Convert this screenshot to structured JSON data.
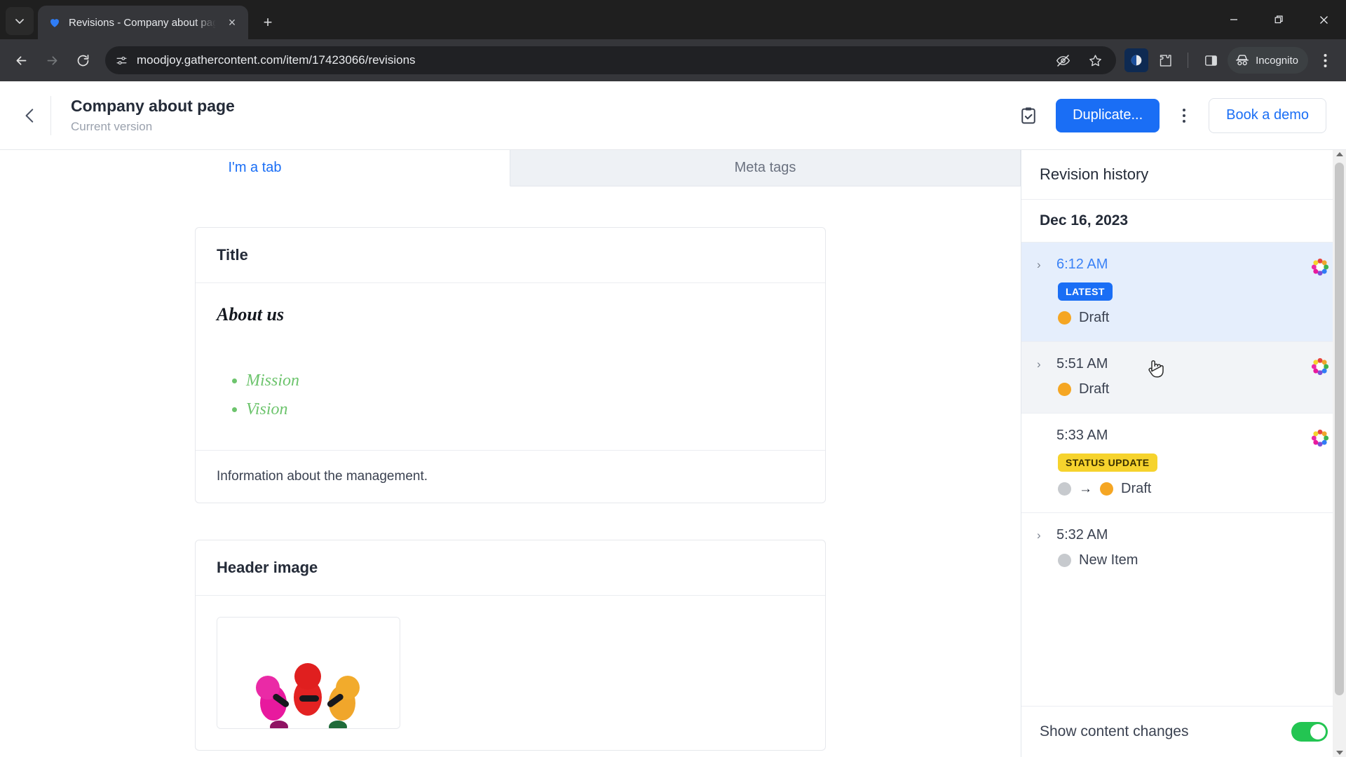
{
  "browser": {
    "tab": {
      "title": "Revisions - Company about pag",
      "favicon": "gathercontent-heart-icon",
      "close": "×"
    },
    "new_tab": "+",
    "window_controls": {
      "minimize": "—",
      "maximize": "❐",
      "close": "✕"
    },
    "toolbar": {
      "back": "←",
      "forward": "→",
      "reload": "↻",
      "site_info": "site-settings-icon",
      "url": "moodjoy.gathercontent.com/item/17423066/revisions",
      "hide_icon": "eye-slash-icon",
      "bookmark_icon": "star-icon",
      "extension_puzzle": "puzzle-piece-icon",
      "side_panel": "side-panel-icon",
      "profile_label": "Incognito",
      "menu": "kebab-menu-icon"
    }
  },
  "app": {
    "header": {
      "back": "back-chevron",
      "title": "Company about page",
      "subtitle": "Current version",
      "clipboard_icon": "clipboard-check-icon",
      "duplicate_label": "Duplicate...",
      "more_menu": "more-options",
      "book_demo_label": "Book a demo"
    },
    "tabs": [
      {
        "label": "I'm a tab",
        "active": true
      },
      {
        "label": "Meta tags",
        "active": false
      }
    ],
    "content": {
      "cards": [
        {
          "heading": "Title",
          "rich_heading": "About us",
          "bullets": [
            "Mission",
            "Vision"
          ],
          "footer_text": "Information about the management."
        },
        {
          "heading": "Header image",
          "image_alt": "colorful-people-illustration"
        }
      ]
    }
  },
  "panel": {
    "title": "Revision history",
    "date_group": "Dec 16, 2023",
    "revisions": [
      {
        "time": "6:12 AM",
        "expandable": true,
        "selected": true,
        "hovered": false,
        "badge": "LATEST",
        "badge_type": "latest",
        "status": "Draft",
        "status_from": null,
        "avatar": "rosette-avatar-icon"
      },
      {
        "time": "5:51 AM",
        "expandable": true,
        "selected": false,
        "hovered": true,
        "badge": null,
        "badge_type": null,
        "status": "Draft",
        "status_from": null,
        "avatar": "rosette-avatar-icon"
      },
      {
        "time": "5:33 AM",
        "expandable": false,
        "selected": false,
        "hovered": false,
        "badge": "STATUS UPDATE",
        "badge_type": "status",
        "status": "Draft",
        "status_from": "none",
        "avatar": "rosette-avatar-icon"
      },
      {
        "time": "5:32 AM",
        "expandable": true,
        "selected": false,
        "hovered": false,
        "badge": null,
        "badge_type": null,
        "status": "New Item",
        "status_from": null,
        "avatar": null
      }
    ],
    "footer": {
      "label": "Show content changes",
      "toggle_on": true
    }
  },
  "colors": {
    "accent_blue": "#1a6ef5",
    "selected_row": "#e5eefc",
    "draft_orange": "#f5a623",
    "status_yellow": "#f6d32d",
    "toggle_green": "#23c552",
    "bullet_green": "#6dc46d"
  }
}
